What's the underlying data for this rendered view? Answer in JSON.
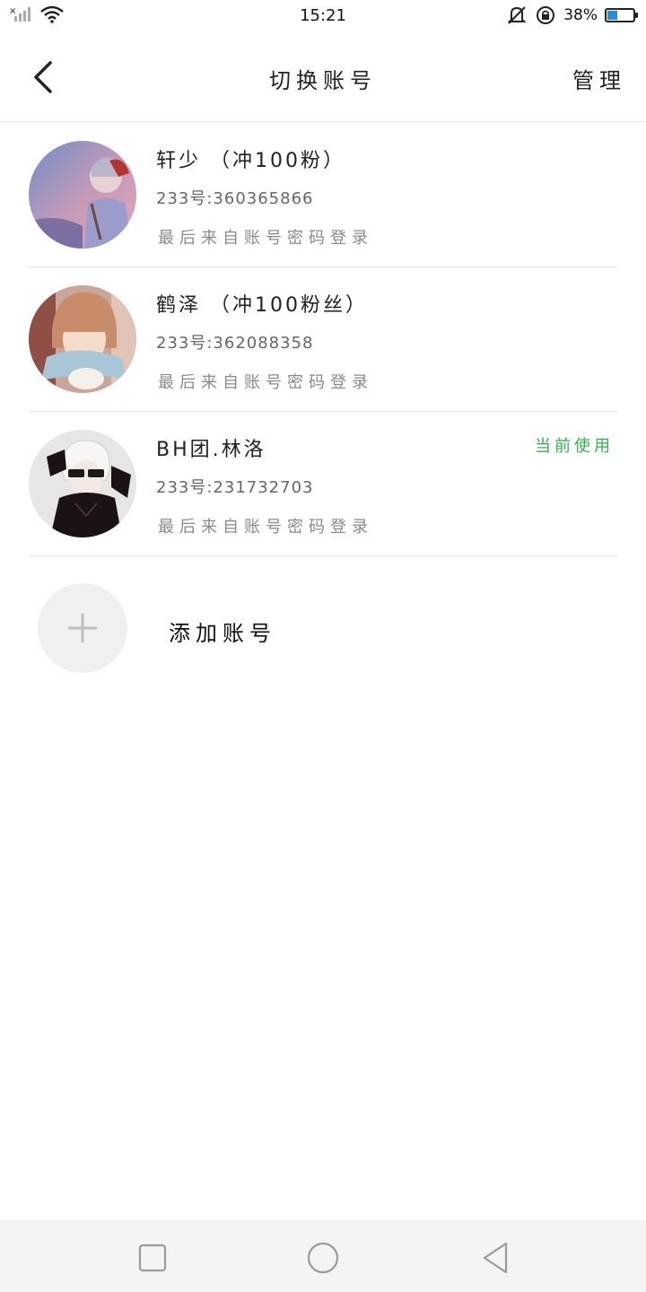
{
  "status_bar": {
    "time": "15:21",
    "battery_text": "38%",
    "battery_level": 0.38,
    "icons": [
      "signal-off-icon",
      "wifi-icon",
      "mute-icon",
      "rotation-lock-icon",
      "battery-charging-icon"
    ]
  },
  "header": {
    "title": "切换账号",
    "manage_label": "管理",
    "back_icon": "back-arrow-icon"
  },
  "accounts": [
    {
      "name": "轩少 （冲100粉）",
      "id_text": "233号:360365866",
      "login_text": "最后来自账号密码登录",
      "current": false
    },
    {
      "name": "鹤泽 （冲100粉丝）",
      "id_text": "233号:362088358",
      "login_text": "最后来自账号密码登录",
      "current": false
    },
    {
      "name": "BH团.林洛",
      "id_text": "233号:231732703",
      "login_text": "最后来自账号密码登录",
      "current": true,
      "current_label": "当前使用"
    }
  ],
  "add_account": {
    "label": "添加账号",
    "icon": "plus-icon"
  },
  "nav_bar": {
    "icons": [
      "recent-apps-icon",
      "home-icon",
      "back-icon"
    ]
  },
  "colors": {
    "accent_green": "#32b24a",
    "divider": "#e6e6e6",
    "nav_bg": "#f4f4f4"
  }
}
